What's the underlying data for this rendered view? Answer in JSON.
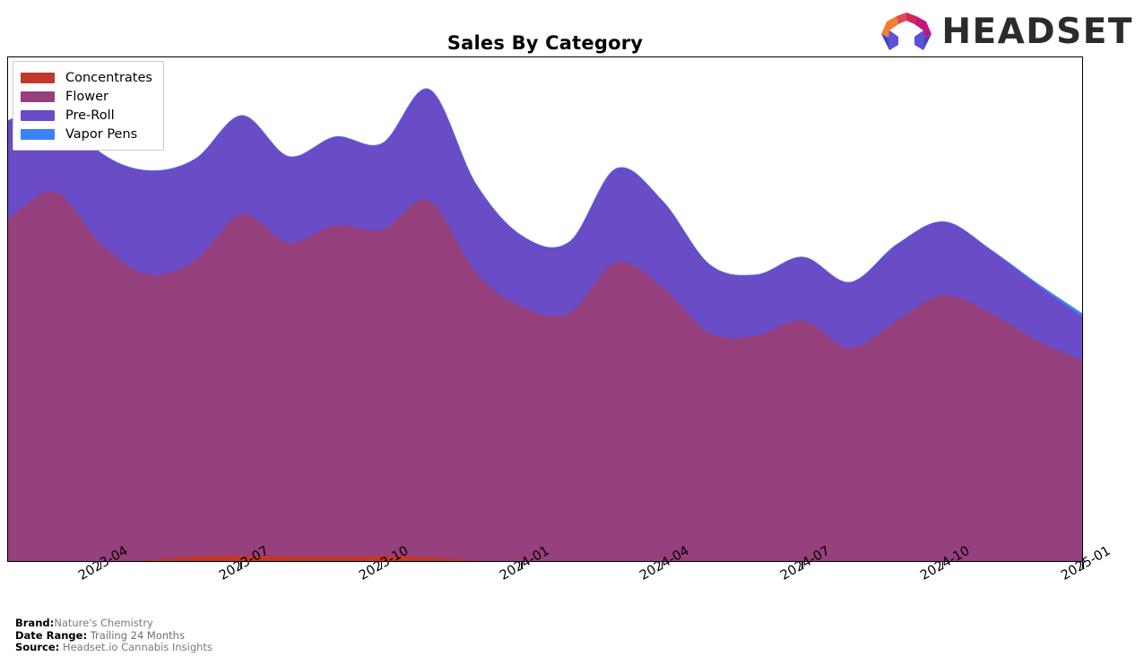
{
  "header": {
    "title": "Sales By Category",
    "logo_text": "HEADSET",
    "logo_mark_name": "headset-logo-mark"
  },
  "legend": {
    "position": "top-left",
    "items": [
      {
        "label": "Concentrates",
        "color": "#C0392B"
      },
      {
        "label": "Flower",
        "color": "#96407D"
      },
      {
        "label": "Pre-Roll",
        "color": "#6A4CC6"
      },
      {
        "label": "Vapor Pens",
        "color": "#3B82F6"
      }
    ]
  },
  "footer": {
    "brand_label": "Brand:",
    "brand_value": "Nature's Chemistry",
    "date_range_label": "Date Range:",
    "date_range_value": "Trailing 24 Months",
    "source_label": "Source:",
    "source_value": "Headset.io Cannabis Insights"
  },
  "chart_data": {
    "type": "area",
    "stacked": true,
    "smoothing": "spline",
    "title": "Sales By Category",
    "xlabel": "",
    "ylabel": "",
    "grid": false,
    "y_axis_visible": false,
    "legend_position": "top-left",
    "x_tick_labels": [
      "2023-04",
      "2023-07",
      "2023-10",
      "2024-01",
      "2024-04",
      "2024-07",
      "2024-10",
      "2025-01"
    ],
    "x_tick_rotation": -30,
    "x": [
      "2023-02",
      "2023-03",
      "2023-04",
      "2023-05",
      "2023-06",
      "2023-07",
      "2023-08",
      "2023-09",
      "2023-10",
      "2023-11",
      "2023-12",
      "2024-01",
      "2024-02",
      "2024-03",
      "2024-04",
      "2024-05",
      "2024-06",
      "2024-07",
      "2024-08",
      "2024-09",
      "2024-10",
      "2024-11",
      "2024-12",
      "2025-01"
    ],
    "series": [
      {
        "name": "Concentrates",
        "color": "#C0392B",
        "values": [
          0.0,
          0.0,
          0.0,
          0.6,
          1.4,
          1.5,
          1.4,
          1.3,
          1.5,
          1.2,
          0.5,
          0.1,
          0.0,
          0.0,
          0.0,
          0.0,
          0.0,
          0.0,
          0.0,
          0.0,
          0.0,
          0.0,
          0.0,
          0.0
        ]
      },
      {
        "name": "Flower",
        "color": "#96407D",
        "values": [
          68.0,
          73.5,
          63.0,
          56.5,
          58.5,
          67.5,
          62.0,
          65.5,
          64.5,
          70.5,
          57.0,
          50.5,
          49.5,
          59.5,
          54.5,
          45.5,
          45.0,
          48.0,
          42.5,
          48.0,
          53.0,
          49.5,
          44.0,
          40.0
        ]
      },
      {
        "name": "Pre-Roll",
        "color": "#6A4CC6",
        "values": [
          19.5,
          17.0,
          18.0,
          20.5,
          20.0,
          19.5,
          17.0,
          17.5,
          17.0,
          22.0,
          17.5,
          14.0,
          14.0,
          18.5,
          17.0,
          13.5,
          12.0,
          12.5,
          13.0,
          15.0,
          14.5,
          12.5,
          11.0,
          8.5
        ]
      },
      {
        "name": "Vapor Pens",
        "color": "#3B82F6",
        "values": [
          0.0,
          0.0,
          0.0,
          0.0,
          0.0,
          0.0,
          0.0,
          0.0,
          0.0,
          0.0,
          0.0,
          0.0,
          0.0,
          0.0,
          0.0,
          0.0,
          0.0,
          0.0,
          0.0,
          0.0,
          0.0,
          0.0,
          0.3,
          0.6
        ]
      }
    ],
    "ylim": [
      0,
      100
    ]
  }
}
